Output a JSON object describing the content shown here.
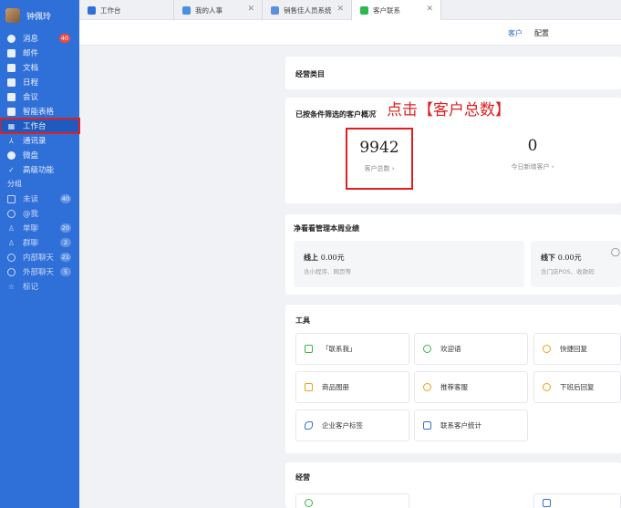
{
  "user": {
    "name": "钟佩玲"
  },
  "nav": {
    "items": [
      {
        "label": "消息",
        "badge": "40",
        "icon": "chat-icon"
      },
      {
        "label": "邮件",
        "icon": "mail-icon"
      },
      {
        "label": "文档",
        "icon": "doc-icon"
      },
      {
        "label": "日程",
        "icon": "calendar-icon"
      },
      {
        "label": "会议",
        "icon": "video-icon"
      },
      {
        "label": "智能表格",
        "icon": "table-icon"
      },
      {
        "label": "工作台",
        "icon": "grid-icon"
      },
      {
        "label": "通讯录",
        "icon": "contacts-icon"
      },
      {
        "label": "微盘",
        "icon": "drive-icon"
      },
      {
        "label": "高级功能",
        "icon": "star-icon"
      }
    ],
    "group_label": "分组",
    "groups": [
      {
        "label": "未读",
        "badge": "40"
      },
      {
        "label": "@我"
      },
      {
        "label": "单聊",
        "badge": "20"
      },
      {
        "label": "群聊",
        "badge": "2"
      },
      {
        "label": "内部聊天",
        "badge": "21"
      },
      {
        "label": "外部聊天",
        "badge": "5"
      },
      {
        "label": "标记"
      }
    ]
  },
  "tabs": [
    {
      "label": "工作台",
      "icon": "grid-icon"
    },
    {
      "label": "我的人事",
      "icon": "person-icon"
    },
    {
      "label": "销售佳人员系统",
      "icon": "app-icon"
    },
    {
      "label": "客户联系",
      "icon": "app-icon"
    }
  ],
  "subheader": {
    "link1": "客户",
    "link2": "配置"
  },
  "cards": {
    "operating_title": "经营类目",
    "overview_title": "已按条件筛选的客户概况",
    "total_value": "9942",
    "total_label": "客户总数 ›",
    "new_value": "0",
    "new_label": "今日新增客户 ›",
    "perf_title": "净看看管理本周业绩",
    "online_label": "线上",
    "online_amount": "0.00元",
    "online_sub": "含小程序、网页等",
    "offline_label": "线下",
    "offline_amount": "0.00元",
    "offline_sub": "含门店POS、收款码",
    "tools_title": "工具",
    "tools": [
      {
        "label": "「联系我」",
        "color": "#3bb34a"
      },
      {
        "label": "欢迎语",
        "color": "#3bb34a"
      },
      {
        "label": "快捷回复",
        "color": "#e8a417"
      },
      {
        "label": "商品图册",
        "color": "#e8a417"
      },
      {
        "label": "推荐客服",
        "color": "#e8a417"
      },
      {
        "label": "下班后回复",
        "color": "#e8a417"
      },
      {
        "label": "企业客户标签",
        "color": "#2f6fd8"
      },
      {
        "label": "联系客户统计",
        "color": "#2f6fd8"
      }
    ],
    "manage_title": "经营"
  },
  "annotation": "点击【客户总数】",
  "colors": {
    "sidebar": "#2f6fd8",
    "highlight": "#e02020",
    "badge": "#f04a3d"
  }
}
